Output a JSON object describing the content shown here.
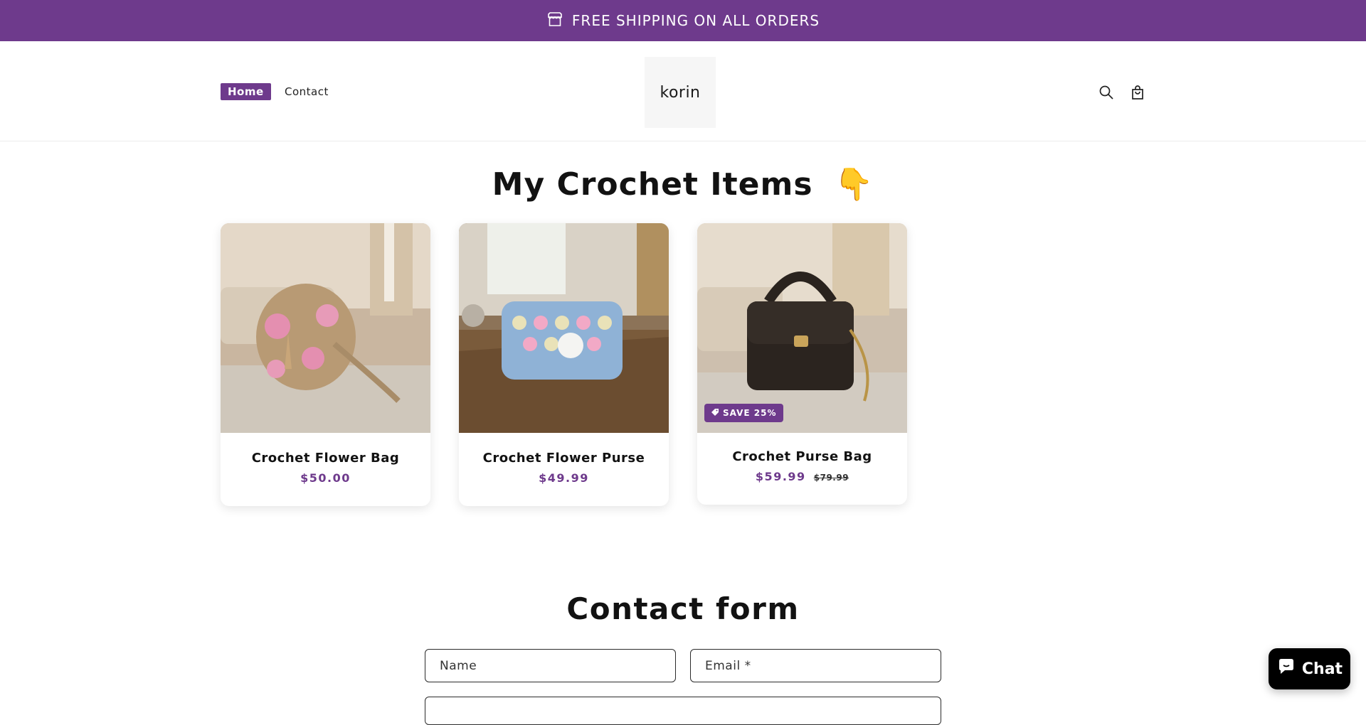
{
  "announcement": {
    "text": "FREE SHIPPING ON ALL ORDERS",
    "icon": "store-icon"
  },
  "header": {
    "nav": [
      {
        "label": "Home",
        "active": true
      },
      {
        "label": "Contact",
        "active": false
      }
    ],
    "logo_text": "korin",
    "icons": [
      "search-icon",
      "cart-icon"
    ]
  },
  "collection": {
    "title": "My Crochet Items",
    "emoji": "👇",
    "products": [
      {
        "title": "Crochet Flower Bag",
        "price": "$50.00",
        "compare_price": "",
        "badge": ""
      },
      {
        "title": "Crochet Flower Purse",
        "price": "$49.99",
        "compare_price": "",
        "badge": ""
      },
      {
        "title": "Crochet Purse Bag",
        "price": "$59.99",
        "compare_price": "$79.99",
        "badge": "SAVE 25%"
      }
    ]
  },
  "contact": {
    "title": "Contact form",
    "name_placeholder": "Name",
    "email_placeholder": "Email *"
  },
  "chat": {
    "label": "Chat"
  },
  "colors": {
    "accent": "#6e3a8c",
    "text": "#121212",
    "chat_bg": "#000000"
  }
}
